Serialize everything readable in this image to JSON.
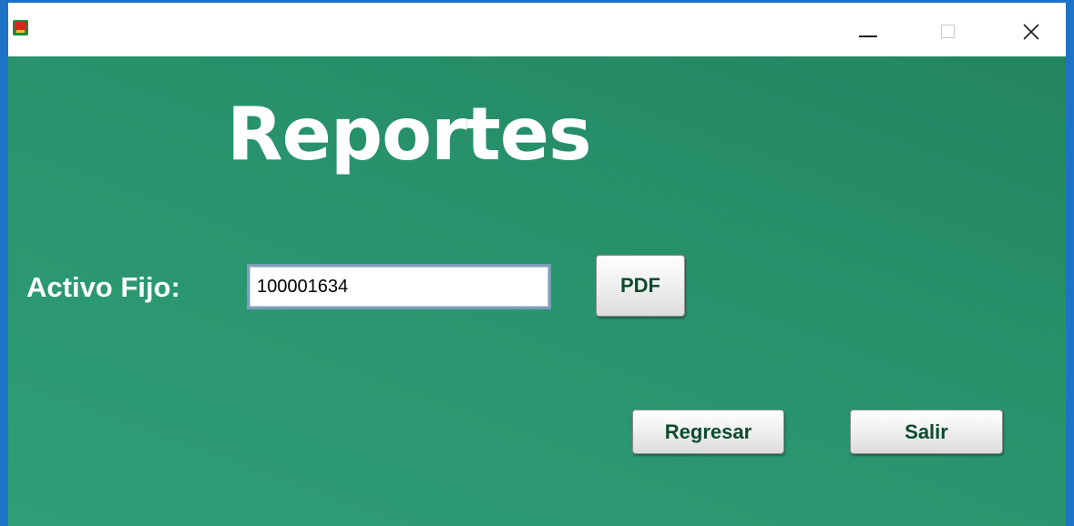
{
  "window": {
    "title": "",
    "controls": {
      "minimize": "minimize-icon",
      "maximize": "maximize-icon",
      "close": "close-icon"
    }
  },
  "page": {
    "heading": "Reportes",
    "field_label": "Activo Fijo:",
    "field_value": "100001634"
  },
  "buttons": {
    "pdf": "PDF",
    "regresar": "Regresar",
    "salir": "Salir"
  },
  "colors": {
    "background": "#28936c",
    "titlebar": "#ffffff",
    "window_border": "#1e73c8",
    "button_text": "#0d4a2d"
  }
}
